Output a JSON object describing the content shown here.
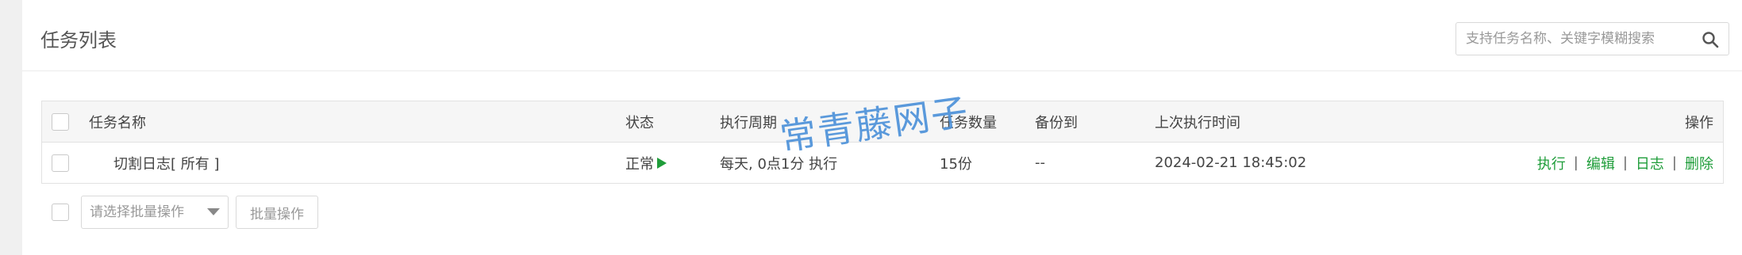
{
  "header": {
    "title": "任务列表",
    "search_placeholder": "支持任务名称、关键字模糊搜索",
    "search_icon": "search-icon"
  },
  "table": {
    "columns": {
      "name": "任务名称",
      "status": "状态",
      "cycle": "执行周期",
      "count": "任务数量",
      "backup_to": "备份到",
      "last_run": "上次执行时间",
      "ops": "操作"
    },
    "rows": [
      {
        "name": "切割日志[ 所有 ]",
        "status": "正常",
        "status_icon": "play-icon",
        "cycle": "每天, 0点1分 执行",
        "count": "15份",
        "backup_to": "--",
        "last_run": "2024-02-21 18:45:02",
        "ops": {
          "run": "执行",
          "edit": "编辑",
          "log": "日志",
          "delete": "删除",
          "separator": "|"
        }
      }
    ]
  },
  "footer": {
    "batch_select_placeholder": "请选择批量操作",
    "batch_button": "批量操作"
  },
  "watermark": "常青藤网子",
  "colors": {
    "accent_green": "#1f9d3a",
    "watermark_blue": "#4a90d9",
    "header_bg": "#f6f6f6"
  }
}
